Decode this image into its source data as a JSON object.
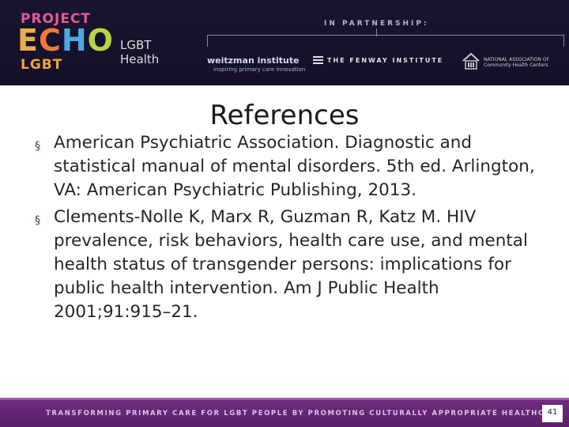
{
  "header": {
    "logo": {
      "project": "PROJECT",
      "echo": "ECHO",
      "lgbt": "LGBT",
      "subtitle": "LGBT Health"
    },
    "partnership_label": "IN PARTNERSHIP:",
    "partners": {
      "weitzman": "weitzman institute",
      "weitzman_tagline": "inspiring primary care innovation",
      "fenway": "THE FENWAY INSTITUTE",
      "nachc": "NATIONAL ASSOCIATION OF Community Health Centers"
    }
  },
  "slide": {
    "title": "References",
    "references": [
      "American Psychiatric Association. Diagnostic and statistical manual of mental disorders. 5th ed. Arlington, VA: American Psychiatric Publishing, 2013.",
      "Clements-Nolle K, Marx R, Guzman R, Katz M. HIV prevalence, risk behaviors, health care use, and mental health status of transgender persons: implications for public health intervention. Am J Public Health 2001;91:915–21."
    ],
    "bullet_glyph": "§"
  },
  "footer": {
    "tagline": "TRANSFORMING PRIMARY CARE FOR LGBT PEOPLE BY PROMOTING CULTURALLY APPROPRIATE HEALTHCARE",
    "page_number": "41"
  },
  "colors": {
    "header_bg": "#15112b",
    "footer_bg": "#6a2878",
    "accent": "#5a2a6a"
  }
}
